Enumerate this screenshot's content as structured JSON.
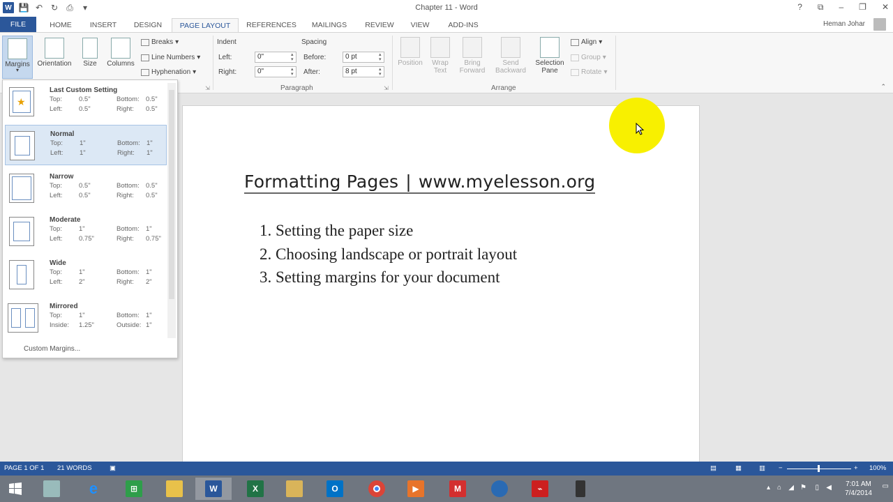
{
  "window": {
    "title": "Chapter 11 - Word",
    "help_glyph": "?",
    "restore_glyph": "⧉",
    "minimize_glyph": "–",
    "maximize_glyph": "❐",
    "close_glyph": "✕"
  },
  "tabs": [
    {
      "label": "FILE"
    },
    {
      "label": "HOME"
    },
    {
      "label": "INSERT"
    },
    {
      "label": "DESIGN"
    },
    {
      "label": "PAGE LAYOUT"
    },
    {
      "label": "REFERENCES"
    },
    {
      "label": "MAILINGS"
    },
    {
      "label": "REVIEW"
    },
    {
      "label": "VIEW"
    },
    {
      "label": "ADD-INS"
    }
  ],
  "user": {
    "name": "Heman Johar"
  },
  "ribbon": {
    "page_setup": {
      "margins": "Margins",
      "orientation": "Orientation",
      "size": "Size",
      "columns": "Columns",
      "breaks": "Breaks",
      "line_numbers": "Line Numbers",
      "hyphenation": "Hyphenation"
    },
    "paragraph": {
      "group_label": "Paragraph",
      "indent_label": "Indent",
      "spacing_label": "Spacing",
      "left_label": "Left:",
      "right_label": "Right:",
      "before_label": "Before:",
      "after_label": "After:",
      "indent_left": "0\"",
      "indent_right": "0\"",
      "spacing_before": "0 pt",
      "spacing_after": "8 pt"
    },
    "arrange": {
      "group_label": "Arrange",
      "position": "Position",
      "wrap_text_1": "Wrap",
      "wrap_text_2": "Text",
      "bring_forward_1": "Bring",
      "bring_forward_2": "Forward",
      "send_backward_1": "Send",
      "send_backward_2": "Backward",
      "selection_pane_1": "Selection",
      "selection_pane_2": "Pane",
      "align": "Align",
      "group": "Group",
      "rotate": "Rotate"
    }
  },
  "margins_menu": {
    "items": [
      {
        "name": "Last Custom Setting",
        "top": "0.5\"",
        "bottom": "0.5\"",
        "left": "0.5\"",
        "right": "0.5\"",
        "top_label": "Top:",
        "bottom_label": "Bottom:",
        "left_label": "Left:",
        "right_label": "Right:"
      },
      {
        "name": "Normal",
        "top": "1\"",
        "bottom": "1\"",
        "left": "1\"",
        "right": "1\"",
        "top_label": "Top:",
        "bottom_label": "Bottom:",
        "left_label": "Left:",
        "right_label": "Right:"
      },
      {
        "name": "Narrow",
        "top": "0.5\"",
        "bottom": "0.5\"",
        "left": "0.5\"",
        "right": "0.5\"",
        "top_label": "Top:",
        "bottom_label": "Bottom:",
        "left_label": "Left:",
        "right_label": "Right:"
      },
      {
        "name": "Moderate",
        "top": "1\"",
        "bottom": "1\"",
        "left": "0.75\"",
        "right": "0.75\"",
        "top_label": "Top:",
        "bottom_label": "Bottom:",
        "left_label": "Left:",
        "right_label": "Right:"
      },
      {
        "name": "Wide",
        "top": "1\"",
        "bottom": "1\"",
        "left": "2\"",
        "right": "2\"",
        "top_label": "Top:",
        "bottom_label": "Bottom:",
        "left_label": "Left:",
        "right_label": "Right:"
      },
      {
        "name": "Mirrored",
        "top": "1\"",
        "bottom": "1\"",
        "left": "1.25\"",
        "right": "1\"",
        "top_label": "Top:",
        "bottom_label": "Bottom:",
        "left_label": "Inside:",
        "right_label": "Outside:"
      }
    ],
    "custom": "Custom Margins..."
  },
  "document": {
    "title_left": "Formatting Pages",
    "title_sep": "|",
    "title_right": "www.myelesson.org",
    "list": [
      {
        "num": "1.",
        "text": "Setting the paper size"
      },
      {
        "num": "2.",
        "text": "Choosing landscape or portrait layout"
      },
      {
        "num": "3.",
        "text": "Setting margins for your document"
      }
    ]
  },
  "status": {
    "page": "PAGE 1 OF 1",
    "words": "21 WORDS",
    "zoom": "100%"
  },
  "taskbar": {
    "time": "7:01 AM",
    "date": "7/4/2014"
  },
  "colors": {
    "accent": "#2b579a",
    "highlight": "#f8f000"
  }
}
